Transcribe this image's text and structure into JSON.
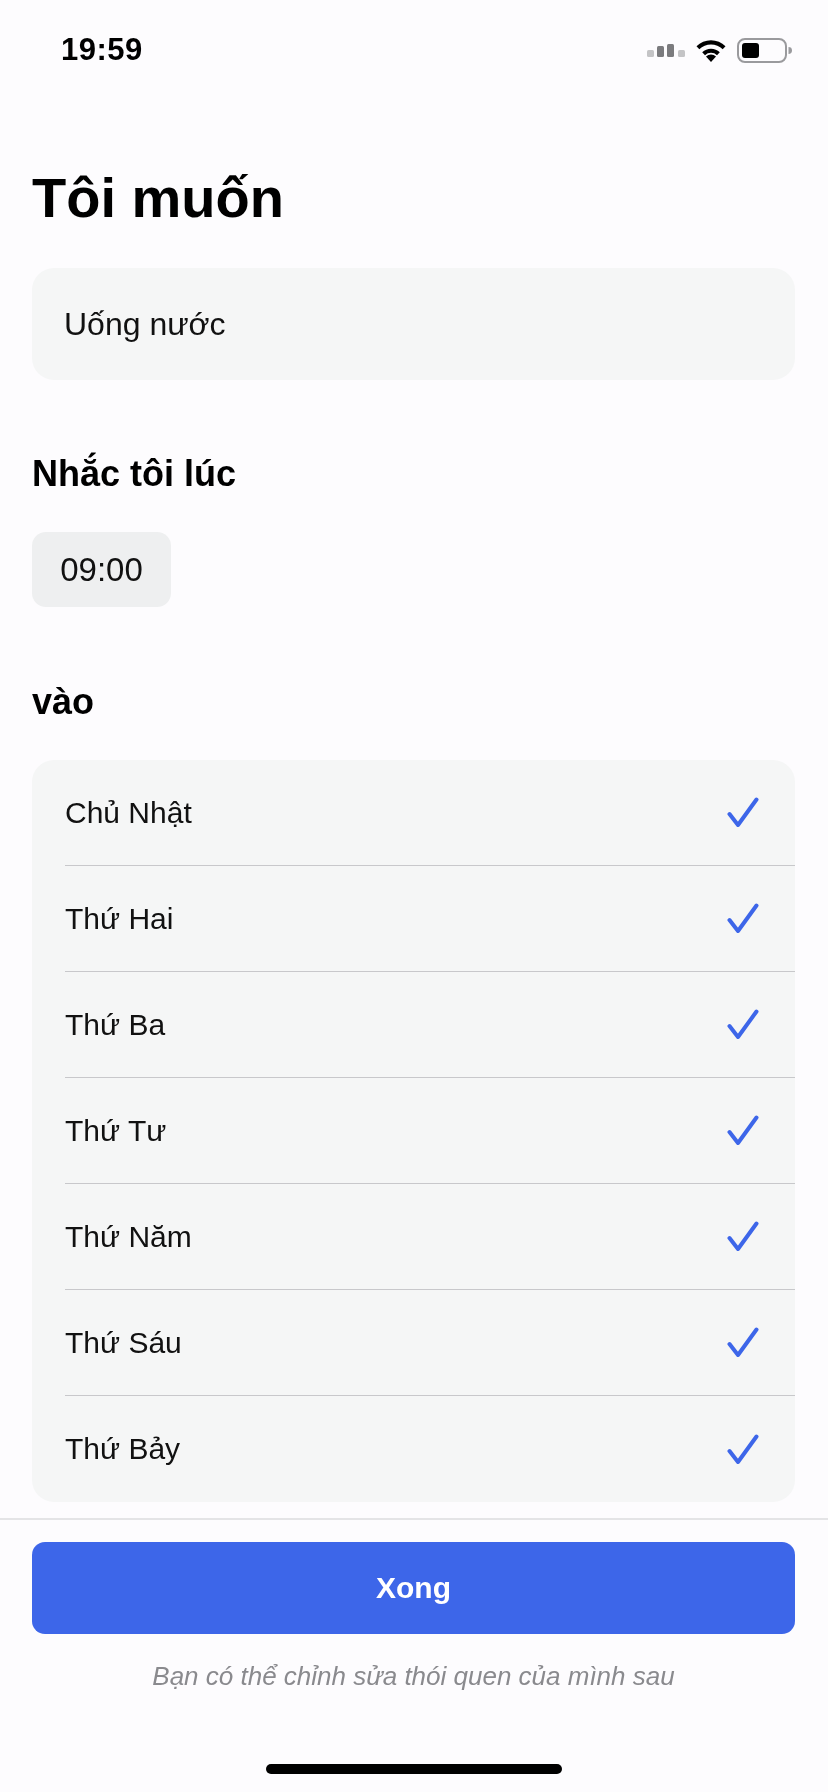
{
  "status_bar": {
    "time": "19:59"
  },
  "title": "Tôi muốn",
  "habit_field": {
    "value": "Uống nước"
  },
  "reminder": {
    "label": "Nhắc tôi lúc",
    "time": "09:00"
  },
  "days": {
    "label": "vào",
    "items": [
      {
        "name": "Chủ Nhật",
        "checked": true
      },
      {
        "name": "Thứ Hai",
        "checked": true
      },
      {
        "name": "Thứ Ba",
        "checked": true
      },
      {
        "name": "Thứ Tư",
        "checked": true
      },
      {
        "name": "Thứ Năm",
        "checked": true
      },
      {
        "name": "Thứ Sáu",
        "checked": true
      },
      {
        "name": "Thứ Bảy",
        "checked": true
      }
    ]
  },
  "done_button": {
    "label": "Xong"
  },
  "footnote": "Bạn có thể chỉnh sửa thói quen của mình sau"
}
